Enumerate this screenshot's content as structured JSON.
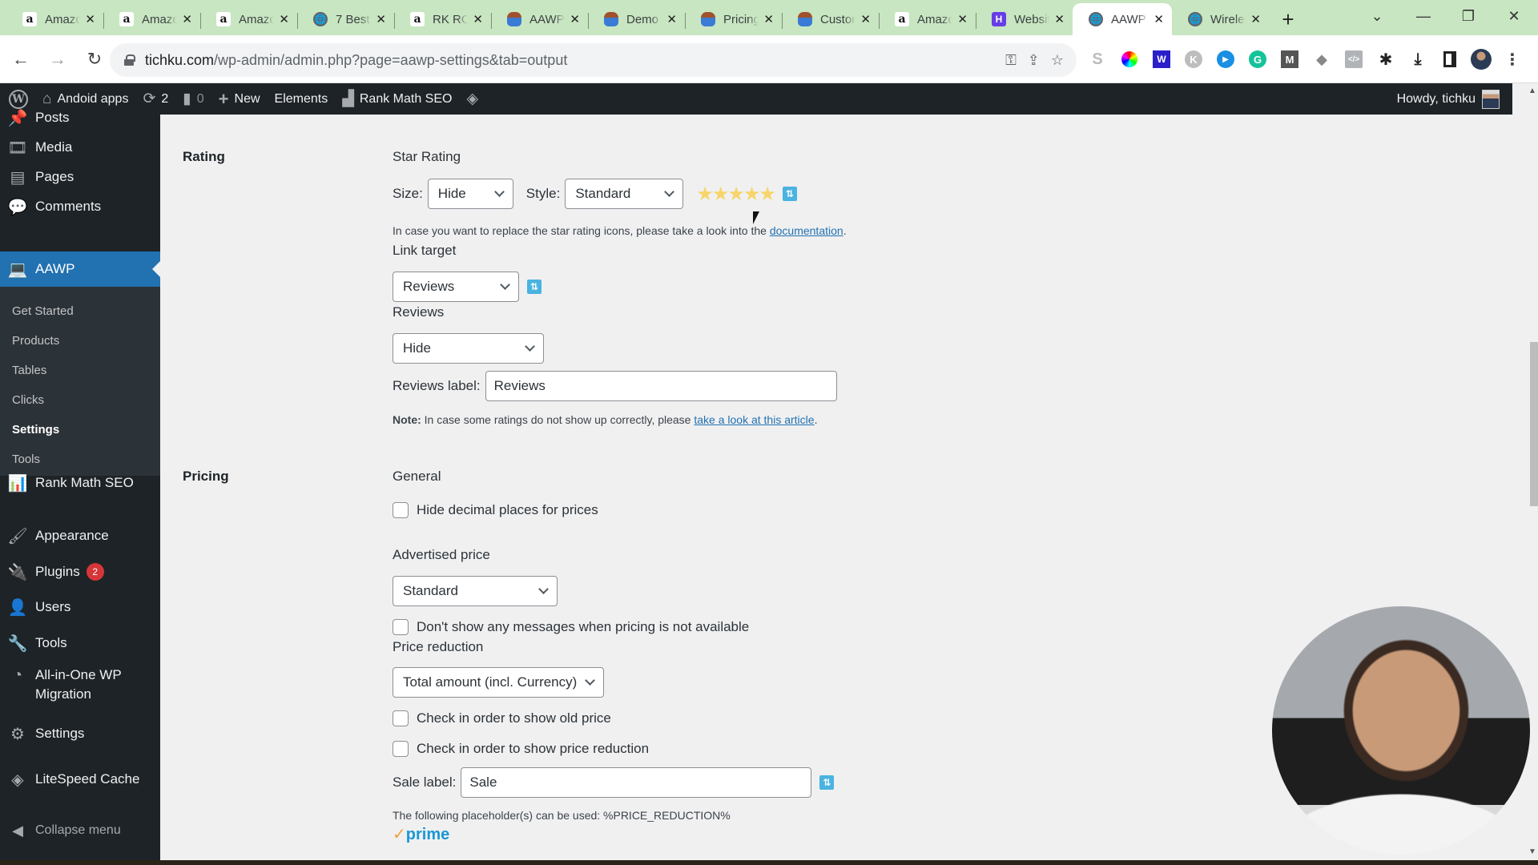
{
  "browser": {
    "tabs": [
      {
        "icon": "amazon-icon",
        "glyph": "a",
        "title": "Amazon",
        "active": false
      },
      {
        "icon": "amazon-icon",
        "glyph": "a",
        "title": "Amazon",
        "active": false
      },
      {
        "icon": "amazon-icon",
        "glyph": "a",
        "title": "Amazon",
        "active": false
      },
      {
        "icon": "globe-icon",
        "glyph": "🌐",
        "title": "7 Best",
        "active": false
      },
      {
        "icon": "amazon-icon",
        "glyph": "a",
        "title": "RK RO",
        "active": false
      },
      {
        "icon": "avatar-icon",
        "glyph": "",
        "title": "AAWP",
        "active": false
      },
      {
        "icon": "avatar-icon",
        "glyph": "",
        "title": "Demo",
        "active": false
      },
      {
        "icon": "avatar-icon",
        "glyph": "",
        "title": "Pricing",
        "active": false
      },
      {
        "icon": "avatar-icon",
        "glyph": "",
        "title": "Custom",
        "active": false
      },
      {
        "icon": "amazon-icon",
        "glyph": "a",
        "title": "Amazon",
        "active": false
      },
      {
        "icon": "hostinger-icon",
        "glyph": "H",
        "title": "Website",
        "active": false
      },
      {
        "icon": "globe-icon",
        "glyph": "🌐",
        "title": "AAWP",
        "active": true
      },
      {
        "icon": "globe-icon",
        "glyph": "🌐",
        "title": "Wireless",
        "active": false
      }
    ],
    "close_glyph": "✕",
    "new_tab_glyph": "+",
    "url_host": "tichku.com",
    "url_path": "/wp-admin/admin.php?page=aawp-settings&tab=output"
  },
  "adminbar": {
    "site_name": "Andoid apps",
    "updates_count": "2",
    "comments_count": "0",
    "new_label": "New",
    "elements_label": "Elements",
    "rankmath_label": "Rank Math SEO",
    "greeting": "Howdy, tichku"
  },
  "sidebar": {
    "items_top": [
      {
        "label": "Posts",
        "icon": "📌"
      },
      {
        "label": "Media",
        "icon": "🎞"
      },
      {
        "label": "Pages",
        "icon": "▤"
      },
      {
        "label": "Comments",
        "icon": "💬"
      }
    ],
    "current": {
      "label": "AAWP",
      "icon": "💻"
    },
    "submenu": [
      {
        "label": "Get Started",
        "active": false
      },
      {
        "label": "Products",
        "active": false
      },
      {
        "label": "Tables",
        "active": false
      },
      {
        "label": "Clicks",
        "active": false
      },
      {
        "label": "Settings",
        "active": true
      },
      {
        "label": "Tools",
        "active": false
      }
    ],
    "items_bottom": [
      {
        "label": "Rank Math SEO",
        "icon": "📊"
      },
      {
        "label": "Appearance",
        "icon": "🖌"
      },
      {
        "label": "Plugins",
        "icon": "🔌",
        "badge": "2"
      },
      {
        "label": "Users",
        "icon": "👤"
      },
      {
        "label": "Tools",
        "icon": "🔧"
      },
      {
        "label": "All-in-One WP Migration",
        "icon": "◔"
      },
      {
        "label": "Settings",
        "icon": "⚙"
      },
      {
        "label": "LiteSpeed Cache",
        "icon": "◈"
      }
    ],
    "collapse_label": "Collapse menu"
  },
  "rating": {
    "section_label": "Rating",
    "star_rating_label": "Star Rating",
    "size_label": "Size:",
    "size_value": "Hide",
    "style_label": "Style:",
    "style_value": "Standard",
    "stars_glyph": "★★★★★",
    "stars_count": 5,
    "doc_text": "In case you want to replace the star rating icons, please take a look into the ",
    "doc_link": "documentation",
    "doc_end": ".",
    "link_target_label": "Link target",
    "link_target_value": "Reviews",
    "reviews_label": "Reviews",
    "reviews_value": "Hide",
    "reviews_label_field_label": "Reviews label:",
    "reviews_label_field_value": "Reviews",
    "note_bold": "Note:",
    "note_text": " In case some ratings do not show up correctly, please ",
    "note_link": "take a look at this article",
    "note_end": "."
  },
  "pricing": {
    "section_label": "Pricing",
    "general_label": "General",
    "hide_decimal_label": "Hide decimal places for prices",
    "hide_decimal_checked": false,
    "advertised_price_label": "Advertised price",
    "advertised_price_value": "Standard",
    "no_messages_label": "Don't show any messages when pricing is not available",
    "no_messages_checked": false,
    "price_reduction_label": "Price reduction",
    "price_reduction_value": "Total amount (incl. Currency)",
    "old_price_label": "Check in order to show old price",
    "old_price_checked": false,
    "show_reduction_label": "Check in order to show price reduction",
    "show_reduction_checked": false,
    "sale_label_label": "Sale label:",
    "sale_label_value": "Sale",
    "placeholder_text": "The following placeholder(s) can be used: %PRICE_REDUCTION%",
    "prime_tick": "✓",
    "prime_text": "prime"
  },
  "colors": {
    "wp_dark": "#1d2327",
    "wp_blue": "#2271b1",
    "tab_strip": "#c8e6c1",
    "help_icon": "#4ab3e0",
    "star": "#f7d56b",
    "badge_red": "#d63638"
  }
}
